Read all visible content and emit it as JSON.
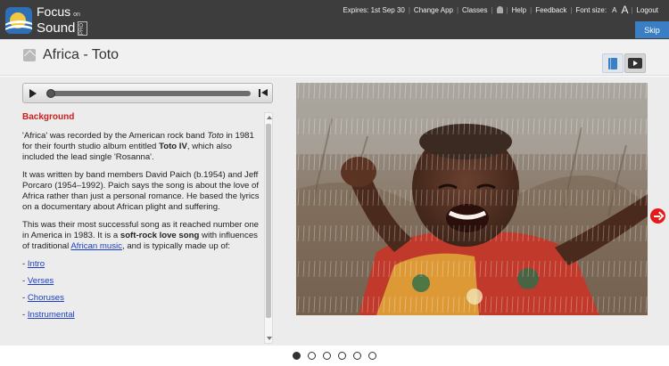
{
  "brand": {
    "line1": "Focus",
    "on": "on",
    "line2": "Sound",
    "badge": "PRO"
  },
  "topnav": {
    "expires": "Expires: 1st Sep 30",
    "change_app": "Change App",
    "classes": "Classes",
    "help": "Help",
    "feedback": "Feedback",
    "font_size": "Font size:",
    "font_small": "A",
    "font_large": "A",
    "logout": "Logout",
    "separator": "|"
  },
  "skip_label": "Skip",
  "page_title": "Africa - Toto",
  "player": {
    "progress": 0.0
  },
  "article": {
    "heading": "Background",
    "p1": {
      "a": "'Africa' was recorded by the American rock band ",
      "b": "Toto",
      "c": " in 1981 for their fourth studio album entitled ",
      "d": "Toto IV",
      "e": ", which also included the lead single 'Rosanna'."
    },
    "p2": "It was written by band members David Paich (b.1954) and Jeff Porcaro (1954–1992). Paich says the song is about the love of Africa rather than just a personal romance. He based the lyrics on a documentary about African plight and suffering.",
    "p3": {
      "a": "This was their most successful song as it reached number one in America in 1983. It is a ",
      "b": "soft-rock love song",
      "c": " with influences of traditional ",
      "link": "African music",
      "d": ", and is typically made up of:"
    },
    "list": [
      {
        "prefix": "- ",
        "label": "Intro"
      },
      {
        "prefix": "- ",
        "label": "Verses"
      },
      {
        "prefix": "- ",
        "label": "Choruses"
      },
      {
        "prefix": "- ",
        "label": "Instrumental"
      }
    ]
  },
  "carousel": {
    "count": 6,
    "active": 0
  },
  "colors": {
    "accent": "#3a7fc4",
    "heading_red": "#cc1f1f",
    "arrow_red": "#e51b1b",
    "topbar": "#3d3d3d"
  },
  "icons": {
    "expand": "expand-icon",
    "book": "book-icon",
    "video": "video-icon",
    "play": "play-icon",
    "skip_end": "skip-end-icon",
    "next": "next-arrow-icon",
    "bell": "bell-icon"
  }
}
